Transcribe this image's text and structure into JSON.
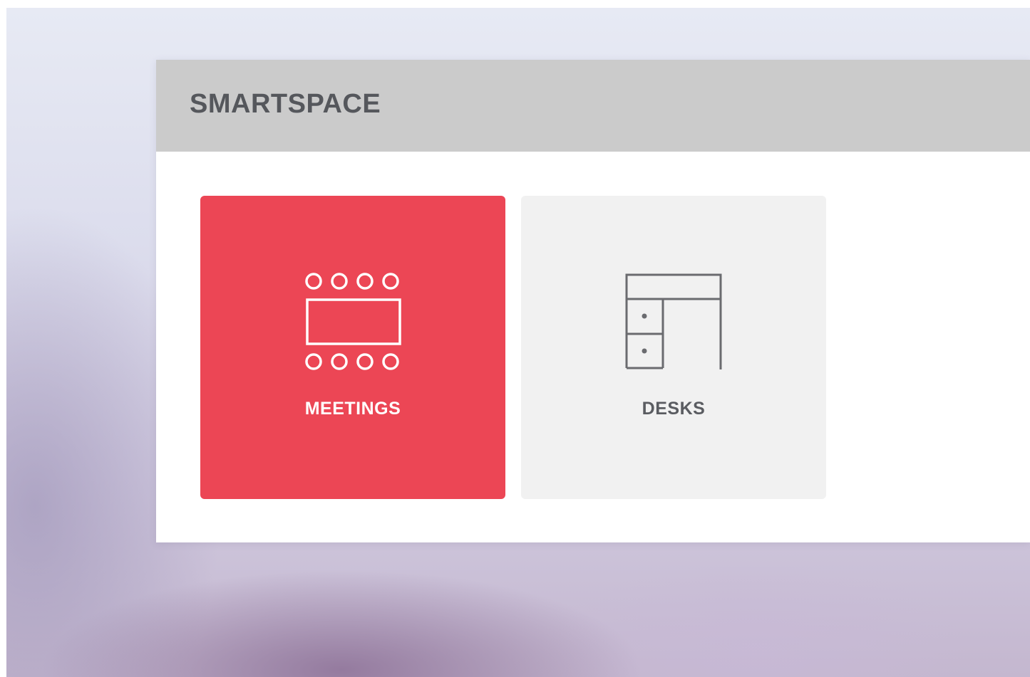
{
  "app": {
    "title": "SMARTSPACE"
  },
  "tiles": [
    {
      "label": "MEETINGS",
      "icon": "meeting-table-icon",
      "selected": true,
      "color": "#ec4655"
    },
    {
      "label": "DESKS",
      "icon": "desk-icon",
      "selected": false,
      "color": "#f1f1f1"
    }
  ]
}
